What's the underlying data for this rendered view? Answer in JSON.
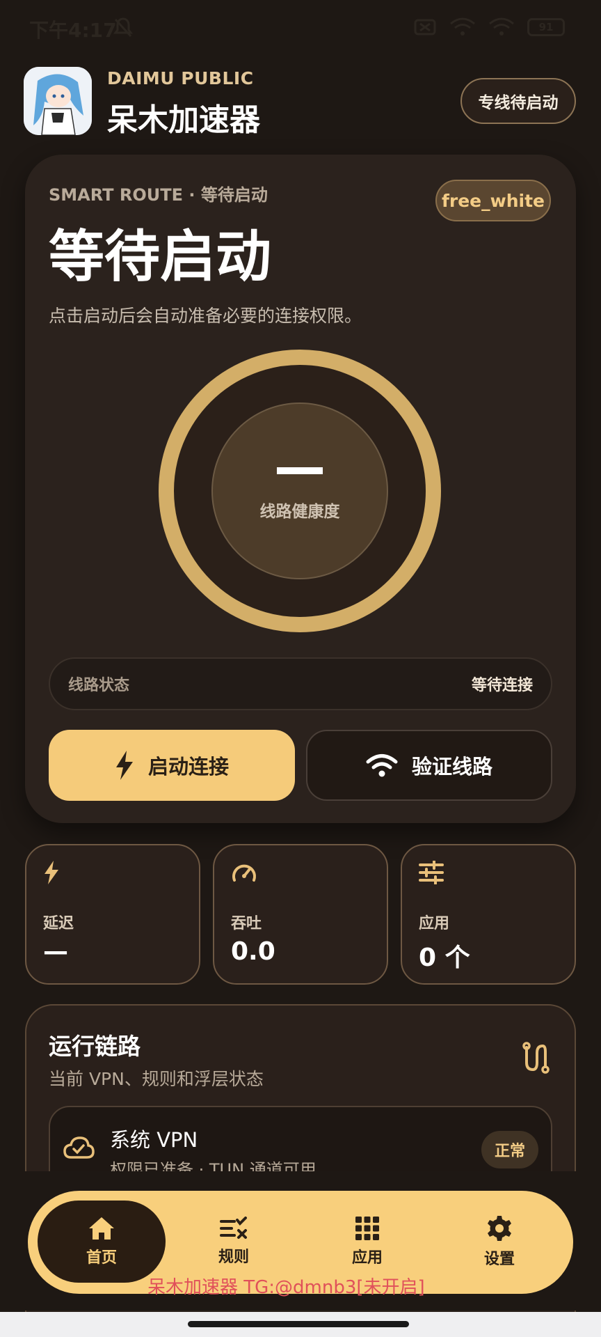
{
  "status_bar": {
    "time": "下午4:17",
    "battery": "91"
  },
  "header": {
    "brand_sub": "DAIMU PUBLIC",
    "brand_title": "呆木加速器",
    "dedicated_button": "专线待启动"
  },
  "main_card": {
    "route_label": "SMART ROUTE · 等待启动",
    "user_badge": "free_white",
    "status_title": "等待启动",
    "hint": "点击启动后会自动准备必要的连接权限。",
    "gauge_value": "—",
    "gauge_label": "线路健康度",
    "route_status_label": "线路状态",
    "route_status_value": "等待连接",
    "start_button": "启动连接",
    "verify_button": "验证线路"
  },
  "stats": [
    {
      "icon": "bolt-icon",
      "label": "延迟",
      "value": "—"
    },
    {
      "icon": "speedometer-icon",
      "label": "吞吐",
      "value": "0.0"
    },
    {
      "icon": "sliders-icon",
      "label": "应用",
      "value": "0 个"
    }
  ],
  "chain": {
    "title": "运行链路",
    "subtitle": "当前 VPN、规则和浮层状态",
    "vpn_title": "系统 VPN",
    "vpn_sub": "权限已准备 · TUN 通道可用",
    "vpn_badge": "正常"
  },
  "nav": {
    "items": [
      {
        "label": "首页",
        "icon": "home-icon",
        "active": true
      },
      {
        "label": "规则",
        "icon": "rules-icon",
        "active": false
      },
      {
        "label": "应用",
        "icon": "apps-grid-icon",
        "active": false
      },
      {
        "label": "设置",
        "icon": "gear-icon",
        "active": false
      }
    ]
  },
  "watermark": "呆木加速器 TG:@dmnb3[未开启]",
  "colors": {
    "accent": "#f5cb7a",
    "background": "#1e1814",
    "card": "#2b221d",
    "ring": "#d3ae68"
  }
}
